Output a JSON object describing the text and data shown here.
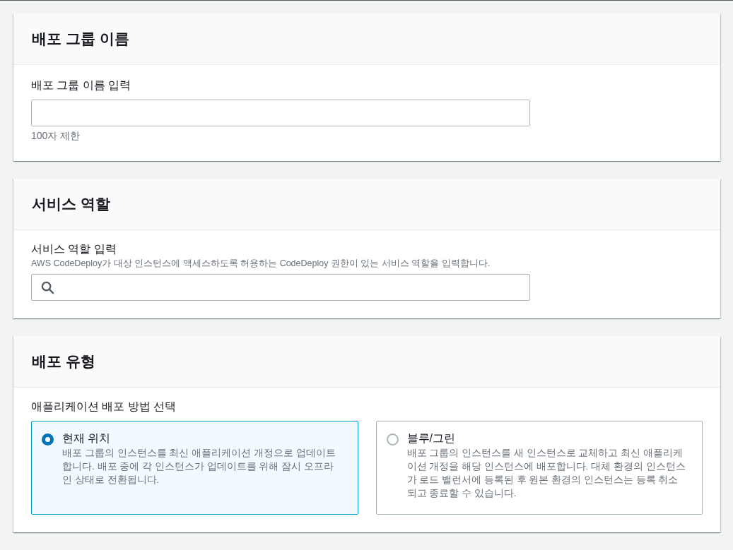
{
  "sections": [
    {
      "title": "배포 그룹 이름",
      "kind": "text",
      "label": "배포 그룹 이름 입력",
      "hint": "100자 제한"
    },
    {
      "title": "서비스 역할",
      "kind": "search",
      "label": "서비스 역할 입력",
      "description": "AWS CodeDeploy가 대상 인스턴스에 액세스하도록 허용하는 CodeDeploy 권한이 있는 서비스 역할을 입력합니다."
    },
    {
      "title": "배포 유형",
      "kind": "radio",
      "label": "애플리케이션 배포 방법 선택",
      "options": [
        {
          "label": "현재 위치",
          "description": "배포 그룹의 인스턴스를 최신 애플리케이션 개정으로 업데이트합니다. 배포 중에 각 인스턴스가 업데이트를 위해 잠시 오프라인 상태로 전환됩니다.",
          "selected": true
        },
        {
          "label": "블루/그린",
          "description": "배포 그룹의 인스턴스를 새 인스턴스로 교체하고 최신 애플리케이션 개정을 해당 인스턴스에 배포합니다. 대체 환경의 인스턴스가 로드 밸런서에 등록된 후 원본 환경의 인스턴스는 등록 취소되고 종료할 수 있습니다.",
          "selected": false
        }
      ]
    }
  ]
}
